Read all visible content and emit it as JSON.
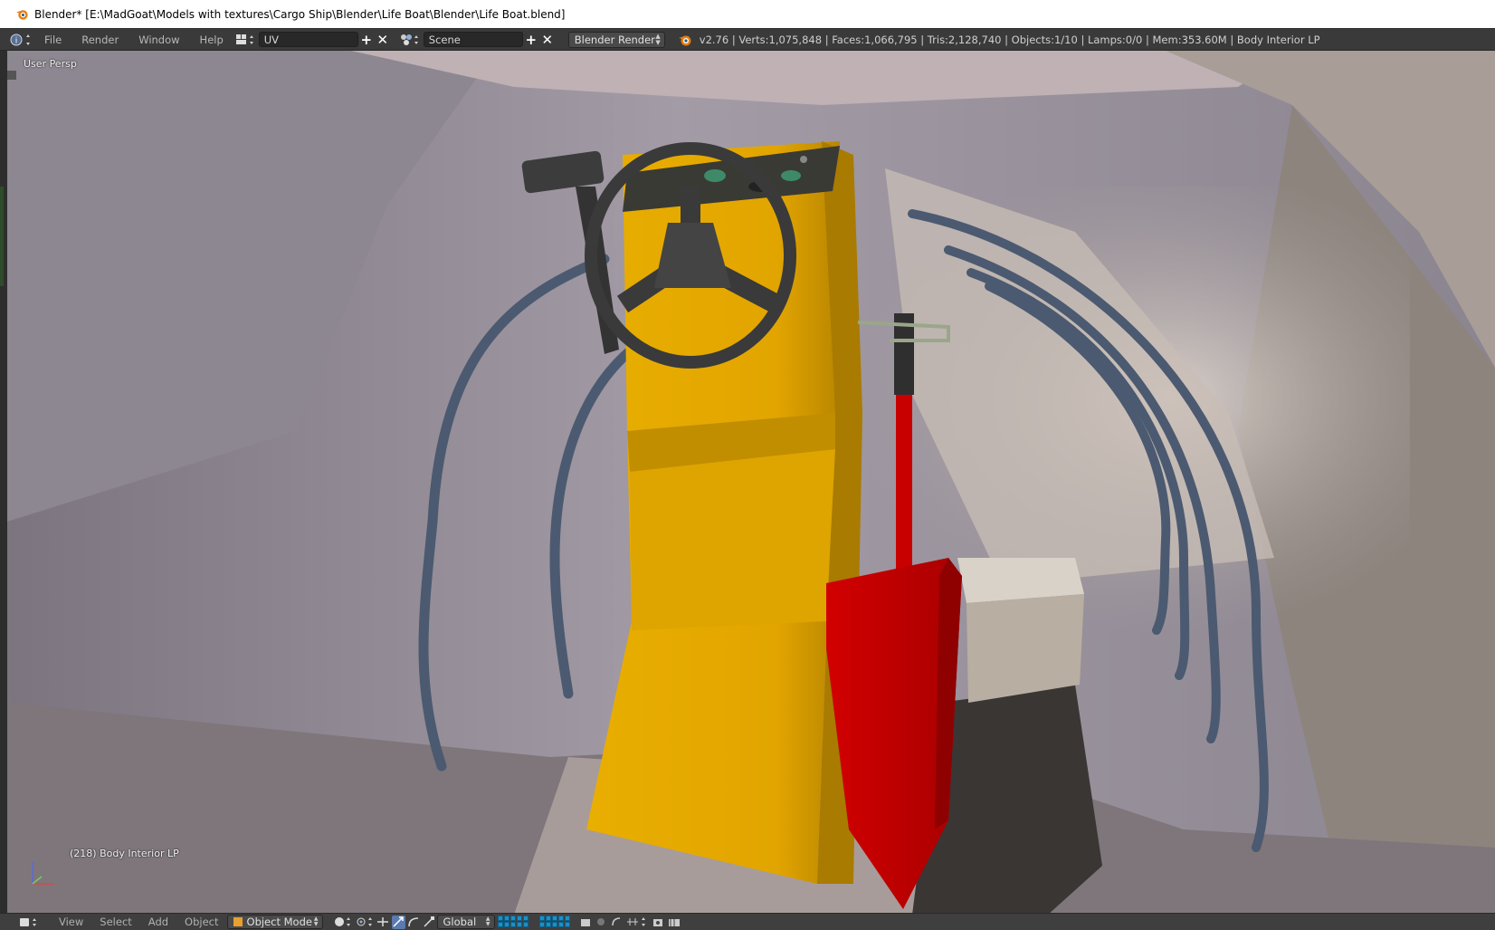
{
  "window": {
    "title": "Blender* [E:\\MadGoat\\Models with textures\\Cargo Ship\\Blender\\Life Boat\\Blender\\Life Boat.blend]"
  },
  "info_header": {
    "menus": [
      "File",
      "Render",
      "Window",
      "Help"
    ],
    "screen_layout": "UV",
    "scene": "Scene",
    "render_engine": "Blender Render",
    "stats": "v2.76 | Verts:1,075,848 | Faces:1,066,795 | Tris:2,128,740 | Objects:1/10 | Lamps:0/0 | Mem:353.60M | Body Interior LP"
  },
  "viewport": {
    "view_name": "User Persp",
    "object_info": "(218) Body Interior LP"
  },
  "view3d_header": {
    "menus": [
      "View",
      "Select",
      "Add",
      "Object"
    ],
    "mode": "Object Mode",
    "orientation": "Global"
  },
  "icons": {
    "title_logo": "blender-logo-icon",
    "info_editor": "info-editor-icon",
    "screen_layout": "screen-layout-icon",
    "scene": "scene-icon",
    "add": "plus-icon",
    "remove": "close-icon",
    "render_logo": "blender-logo-icon",
    "editor_type": "view3d-editor-icon",
    "mode": "object-mode-cube-icon",
    "shading": "solid-shading-icon",
    "pivot": "pivot-point-icon",
    "manipulator": "manipulator-icon",
    "translate": "translate-icon",
    "rotate": "rotate-icon",
    "scale": "scale-icon",
    "layers": "layers-grid",
    "lock_layers": "lock-layers-icon",
    "proportional": "proportional-edit-icon",
    "snap": "snap-icon",
    "render_still": "render-camera-icon",
    "render_anim": "render-animation-icon"
  },
  "colors": {
    "console_yellow": "#e4a800",
    "shovel_red": "#cc0000",
    "rail_blue": "#4a5a72",
    "wheel_dark": "#3b3b3b",
    "layer_active": "#1d8fc7"
  }
}
